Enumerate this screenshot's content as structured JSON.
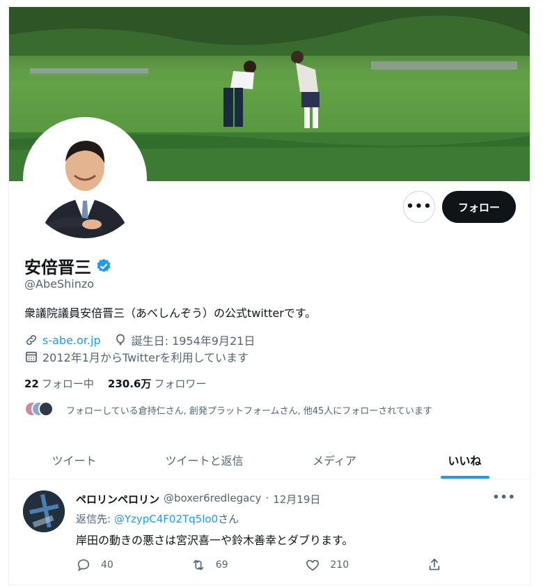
{
  "profile": {
    "name": "安倍晋三",
    "handle": "@AbeShinzo",
    "bio": "衆議院議員安倍晋三（あべしんぞう）の公式twitterです。",
    "website": "s-abe.or.jp",
    "birthday": "誕生日: 1954年9月21日",
    "joined": "2012年1月からTwitterを利用しています",
    "following_count": "22",
    "following_label": "フォロー中",
    "followers_count": "230.6万",
    "followers_label": "フォロワー",
    "known_followers": "フォローしている倉持仁さん, 創発プラットフォームさん, 他45人にフォローされています"
  },
  "buttons": {
    "more_icon": "more-dots-icon",
    "follow_label": "フォロー"
  },
  "tabs": [
    {
      "label": "ツイート"
    },
    {
      "label": "ツイートと返信"
    },
    {
      "label": "メディア"
    },
    {
      "label": "いいね"
    }
  ],
  "active_tab": "いいね",
  "tweet": {
    "author": "ペロリンペロリン",
    "handle": "@boxer6redlegacy",
    "separator": "·",
    "date": "12月19日",
    "reply_prefix": "返信先: ",
    "reply_to": "@YzypC4F02Tq5lo0",
    "reply_suffix": "さん",
    "text": "岸田の動きの悪さは宮沢喜一や鈴木善幸とダブります。",
    "more": "•••",
    "replies": "40",
    "retweets": "69",
    "likes": "210"
  },
  "colors": {
    "accent": "#1d9bf0",
    "text": "#0f1419",
    "muted": "#536471",
    "follow_bg": "#0f1419"
  }
}
